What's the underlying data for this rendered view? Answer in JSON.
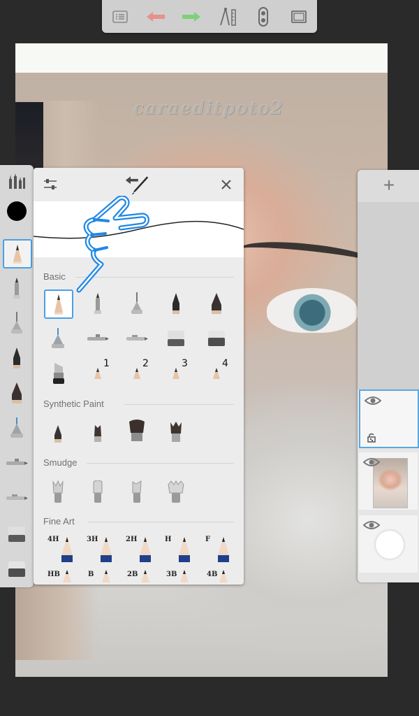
{
  "app": {
    "watermark": "caraeditpoto2"
  },
  "toolbar": {
    "items": [
      {
        "name": "list-icon"
      },
      {
        "name": "undo-icon",
        "color": "#e8908a"
      },
      {
        "name": "redo-icon",
        "color": "#7fd07a"
      },
      {
        "name": "ruler-icon"
      },
      {
        "name": "symmetry-icon"
      },
      {
        "name": "fullscreen-icon"
      }
    ]
  },
  "brush_panel": {
    "sections": {
      "basic": "Basic",
      "synthetic_paint": "Synthetic Paint",
      "smudge": "Smudge",
      "fine_art": "Fine Art"
    },
    "basic_numbers": [
      "1",
      "2",
      "3",
      "4"
    ],
    "fine_art_labels_row1": [
      "4H",
      "3H",
      "2H",
      "H",
      "F"
    ],
    "fine_art_labels_row2": [
      "HB",
      "B",
      "2B",
      "3B",
      "4B"
    ],
    "accent_color": "#4aa0e6",
    "selected_brush": "pencil"
  },
  "left_toolbar": {
    "color_swatch": "#000000",
    "selected": "pencil"
  },
  "layers_panel": {
    "add_label": "+"
  }
}
